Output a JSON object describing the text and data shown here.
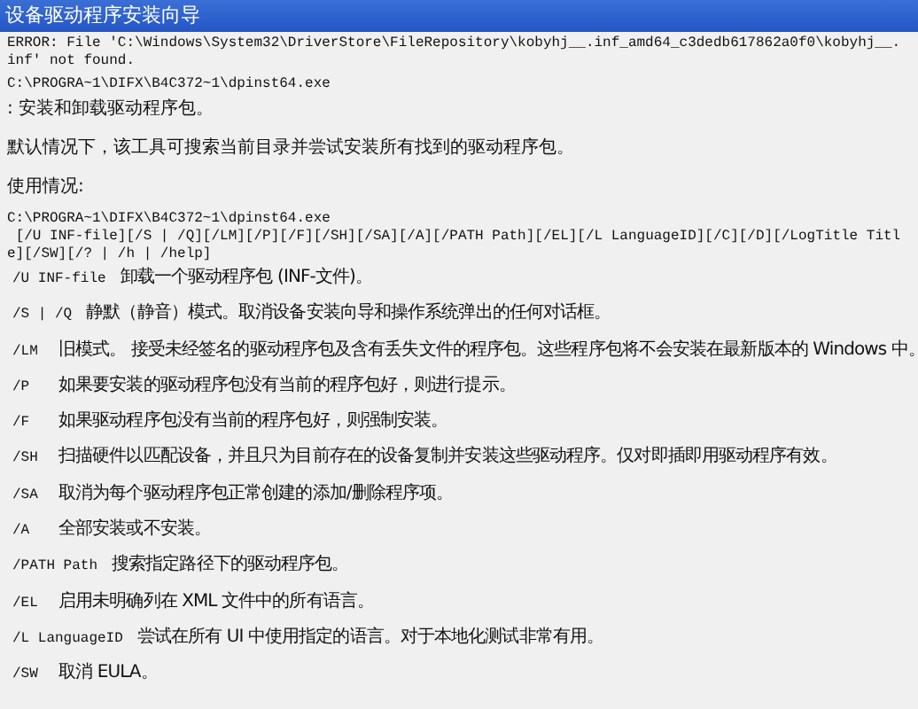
{
  "window": {
    "title": "设备驱动程序安装向导"
  },
  "header_lines": [
    "ERROR: File 'C:\\Windows\\System32\\DriverStore\\FileRepository\\kobyhj__.inf_amd64_c3dedb617862a0f0\\kobyhj__.inf' not found.",
    "C:\\PROGRA~1\\DIFX\\B4C372~1\\dpinst64.exe",
    ": 安装和卸载驱动程序包。"
  ],
  "description": "默认情况下，该工具可搜索当前目录并尝试安装所有找到的驱动程序包。",
  "usage_heading": "使用情况:",
  "usage_lines": [
    "C:\\PROGRA~1\\DIFX\\B4C372~1\\dpinst64.exe",
    " [/U INF-file][/S | /Q][/LM][/P][/F][/SH][/SA][/A][/PATH Path][/EL][/L LanguageID][/C][/D][/LogTitle Title][/SW][/? | /h | /help]"
  ],
  "options": [
    {
      "switch": "/U INF-file",
      "text": "卸载一个驱动程序包 (INF-文件)。"
    },
    {
      "switch": "/S | /Q",
      "text": "静默（静音）模式。取消设备安装向导和操作系统弹出的任何对话框。"
    },
    {
      "switch": "/LM",
      "text": "旧模式。 接受未经签名的驱动程序包及含有丢失文件的程序包。这些程序包将不会安装在最新版本的 Windows 中。"
    },
    {
      "switch": "/P",
      "text": "如果要安装的驱动程序包没有当前的程序包好，则进行提示。"
    },
    {
      "switch": "/F",
      "text": "如果驱动程序包没有当前的程序包好，则强制安装。"
    },
    {
      "switch": "/SH",
      "text": "扫描硬件以匹配设备，并且只为目前存在的设备复制并安装这些驱动程序。仅对即插即用驱动程序有效。"
    },
    {
      "switch": "/SA",
      "text": "取消为每个驱动程序包正常创建的添加/删除程序项。"
    },
    {
      "switch": "/A",
      "text": "全部安装或不安装。"
    },
    {
      "switch": "/PATH Path",
      "text": "搜索指定路径下的驱动程序包。"
    },
    {
      "switch": "/EL",
      "text": "启用未明确列在 XML 文件中的所有语言。"
    },
    {
      "switch": "/L LanguageID",
      "text": "尝试在所有 UI 中使用指定的语言。对于本地化测试非常有用。"
    },
    {
      "switch": "/SW",
      "text": "取消 EULA。"
    }
  ]
}
